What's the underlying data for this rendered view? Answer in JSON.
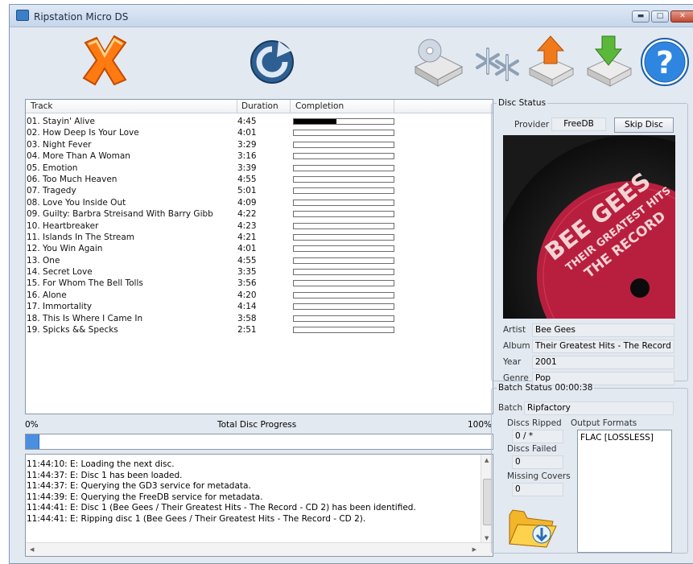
{
  "window": {
    "title": "Ripstation Micro DS",
    "min": "▬",
    "max": "□",
    "close": "✕"
  },
  "toolbar": {
    "items": [
      {
        "name": "cancel",
        "icon": "x-cross-icon"
      },
      {
        "name": "refresh",
        "icon": "refresh-icon"
      },
      {
        "name": "drive",
        "icon": "disc-drive-icon"
      },
      {
        "name": "settings",
        "icon": "snowflake-icon"
      },
      {
        "name": "eject-up",
        "icon": "upload-tray-icon"
      },
      {
        "name": "load-down",
        "icon": "download-tray-icon"
      },
      {
        "name": "help",
        "icon": "help-icon"
      }
    ]
  },
  "tracks": {
    "columns": [
      "Track",
      "Duration",
      "Completion"
    ],
    "rows": [
      {
        "title": "01. Stayin' Alive",
        "duration": "4:45",
        "completion": 0.43
      },
      {
        "title": "02. How Deep Is Your Love",
        "duration": "4:01",
        "completion": 0
      },
      {
        "title": "03. Night Fever",
        "duration": "3:29",
        "completion": 0
      },
      {
        "title": "04. More Than A Woman",
        "duration": "3:16",
        "completion": 0
      },
      {
        "title": "05. Emotion",
        "duration": "3:39",
        "completion": 0
      },
      {
        "title": "06. Too Much Heaven",
        "duration": "4:55",
        "completion": 0
      },
      {
        "title": "07. Tragedy",
        "duration": "5:01",
        "completion": 0
      },
      {
        "title": "08. Love You Inside Out",
        "duration": "4:09",
        "completion": 0
      },
      {
        "title": "09. Guilty: Barbra Streisand With Barry Gibb",
        "duration": "4:22",
        "completion": 0
      },
      {
        "title": "10. Heartbreaker",
        "duration": "4:23",
        "completion": 0
      },
      {
        "title": "11. Islands In The Stream",
        "duration": "4:21",
        "completion": 0
      },
      {
        "title": "12. You Win Again",
        "duration": "4:01",
        "completion": 0
      },
      {
        "title": "13. One",
        "duration": "4:55",
        "completion": 0
      },
      {
        "title": "14. Secret Love",
        "duration": "3:35",
        "completion": 0
      },
      {
        "title": "15. For Whom The Bell Tolls",
        "duration": "3:56",
        "completion": 0
      },
      {
        "title": "16. Alone",
        "duration": "4:20",
        "completion": 0
      },
      {
        "title": "17. Immortality",
        "duration": "4:14",
        "completion": 0
      },
      {
        "title": "18. This Is Where I Came In",
        "duration": "3:58",
        "completion": 0
      },
      {
        "title": "19. Spicks && Specks",
        "duration": "2:51",
        "completion": 0
      }
    ]
  },
  "progress": {
    "min_label": "0%",
    "label": "Total Disc Progress",
    "max_label": "100%",
    "value": 0.03
  },
  "log": {
    "lines": [
      "11:44:10: E: Loading the next disc.",
      "11:44:37: E: Disc 1 has been loaded.",
      "11:44:37: E: Querying the GD3 service for metadata.",
      "11:44:39: E: Querying the FreeDB service for metadata.",
      "11:44:41: E: Disc 1 (Bee Gees / Their Greatest Hits - The Record - CD 2) has been identified.",
      "11:44:41: E: Ripping disc 1 (Bee Gees / Their Greatest Hits - The Record - CD 2)."
    ]
  },
  "disc_status": {
    "legend": "Disc Status",
    "provider_label": "Provider",
    "provider_value": "FreeDB",
    "skip_label": "Skip Disc",
    "cover_text": {
      "line1": "BEE GEES",
      "line2": "THEIR GREATEST HITS",
      "line3": "THE RECORD"
    },
    "artist_label": "Artist",
    "artist": "Bee Gees",
    "album_label": "Album",
    "album": "Their Greatest Hits - The Record - C",
    "year_label": "Year",
    "year": "2001",
    "genre_label": "Genre",
    "genre": "Pop"
  },
  "batch_status": {
    "legend": "Batch Status 00:00:38",
    "batch_label": "Batch",
    "batch": "Ripfactory",
    "discs_ripped_label": "Discs Ripped",
    "discs_ripped": "0 / *",
    "discs_failed_label": "Discs Failed",
    "discs_failed": "0",
    "missing_covers_label": "Missing Covers",
    "missing_covers": "0",
    "output_formats_label": "Output Formats",
    "output_formats": [
      "FLAC [LOSSLESS]"
    ]
  }
}
